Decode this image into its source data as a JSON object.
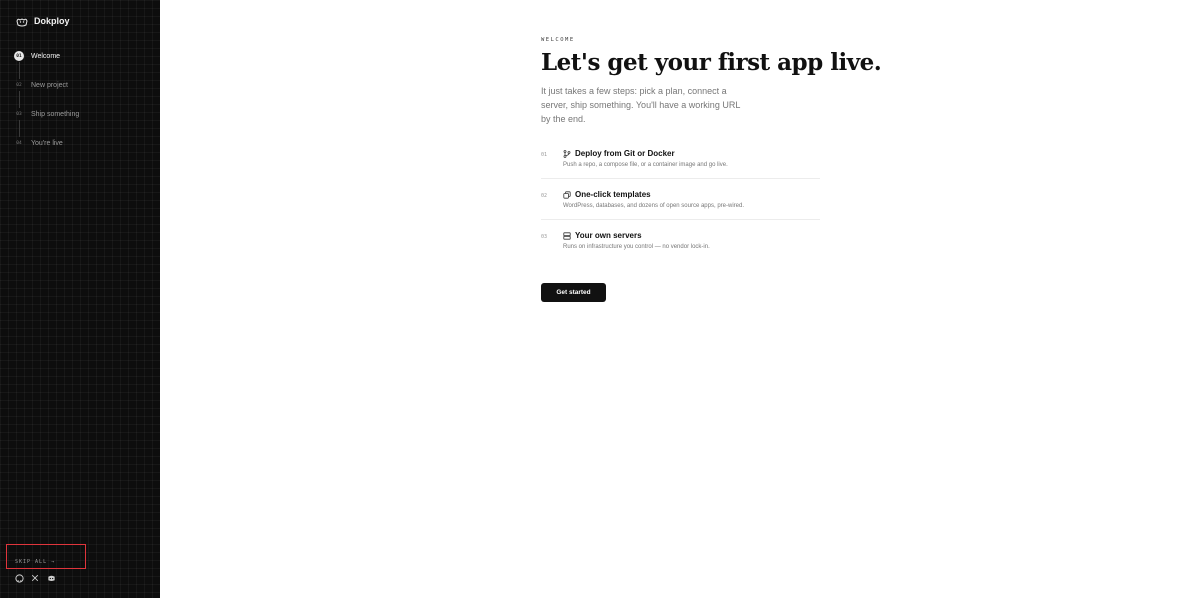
{
  "sidebar": {
    "brand_name": "Dokploy",
    "steps": [
      {
        "num": "01",
        "label": "Welcome",
        "active": true
      },
      {
        "num": "02",
        "label": "New project",
        "active": false
      },
      {
        "num": "03",
        "label": "Ship something",
        "active": false
      },
      {
        "num": "04",
        "label": "You're live",
        "active": false
      }
    ],
    "skip_label": "SKIP ALL →",
    "socials": [
      "github-icon",
      "x-icon",
      "discord-icon"
    ]
  },
  "main": {
    "eyebrow": "WELCOME",
    "headline": "Let's get your first app live.",
    "lead": "It just takes a few steps: pick a plan, connect a server, ship something. You'll have a working URL by the end.",
    "features": [
      {
        "num": "01",
        "icon": "git-branch-icon",
        "title": "Deploy from Git or Docker",
        "desc": "Push a repo, a compose file, or a container image and go live."
      },
      {
        "num": "02",
        "icon": "copy-icon",
        "title": "One-click templates",
        "desc": "WordPress, databases, and dozens of open source apps, pre-wired."
      },
      {
        "num": "03",
        "icon": "server-icon",
        "title": "Your own servers",
        "desc": "Runs on infrastructure you control — no vendor lock-in."
      }
    ],
    "cta_label": "Get started"
  },
  "colors": {
    "sidebar_bg": "#0d0d0d",
    "highlight_box": "#e0353c",
    "cta_bg": "#111111"
  }
}
